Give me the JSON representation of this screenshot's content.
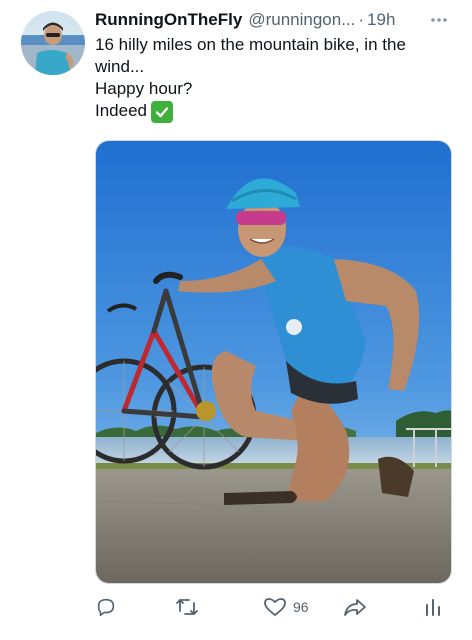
{
  "tweet": {
    "display_name": "RunningOnTheFly",
    "handle": "@runningon...",
    "separator": "·",
    "time": "19h",
    "text_line1": "16 hilly miles on the mountain bike, in the wind...",
    "text_line2": "Happy hour?",
    "text_line3": "Indeed",
    "check_emoji": "✅"
  },
  "actions": {
    "reply_count": "",
    "retweet_count": "",
    "like_count": "96",
    "share_count": ""
  },
  "icons": {
    "more": "more-horizontal-icon",
    "reply": "reply-icon",
    "retweet": "retweet-icon",
    "like": "heart-icon",
    "share": "share-icon",
    "analytics": "analytics-icon"
  },
  "colors": {
    "text": "#0f1419",
    "secondary": "#536471",
    "check_green": "#3fb03c"
  }
}
